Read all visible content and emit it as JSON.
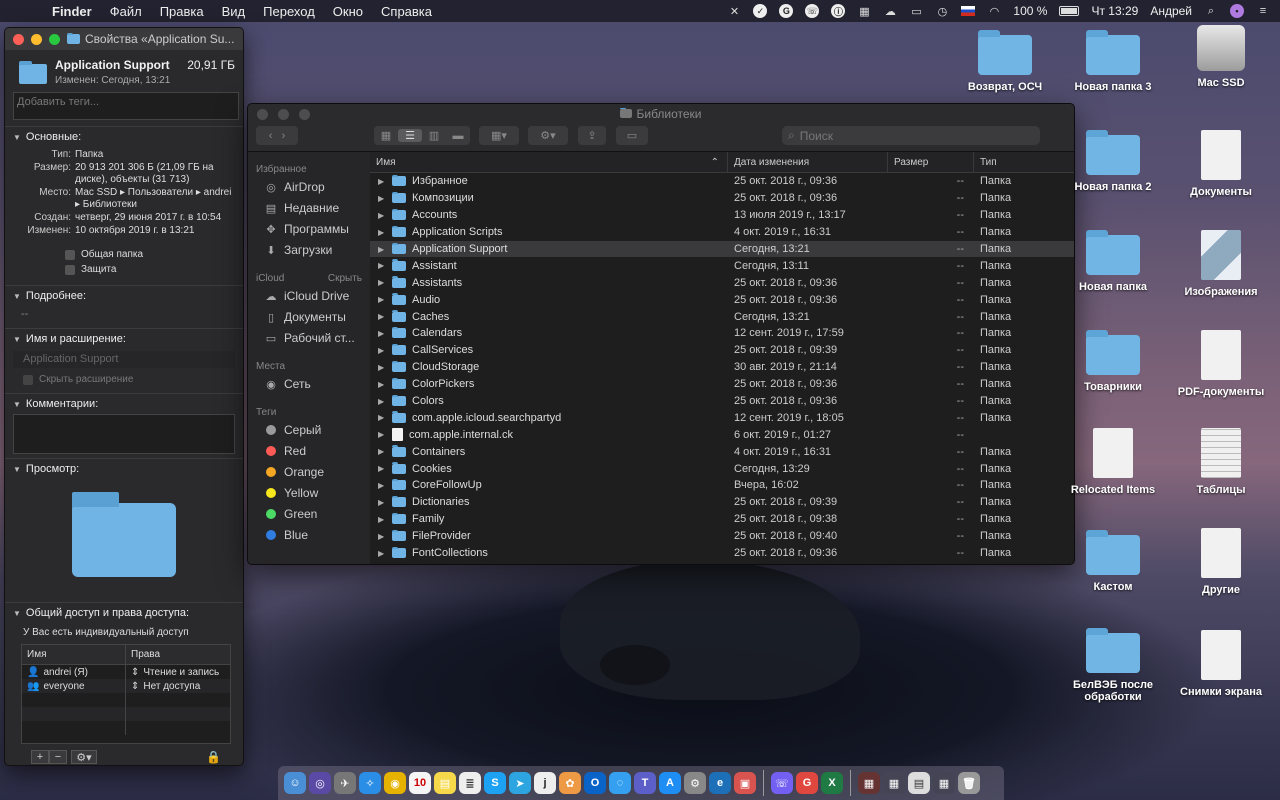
{
  "menubar": {
    "app": "Finder",
    "items": [
      "Файл",
      "Правка",
      "Вид",
      "Переход",
      "Окно",
      "Справка"
    ],
    "battery": "100 %",
    "clock": "Чт 13:29",
    "user": "Андрей"
  },
  "info": {
    "title": "Свойства «Application Su...",
    "name": "Application Support",
    "size": "20,91 ГБ",
    "modified": "Изменен: Сегодня, 13:21",
    "tags_placeholder": "Добавить теги...",
    "general": {
      "header": "Основные:",
      "kind_k": "Тип:",
      "kind_v": "Папка",
      "size_k": "Размер:",
      "size_v": "20 913 201 306 Б (21,09 ГБ на диске), объекты (31 713)",
      "where_k": "Место:",
      "where_v": "Mac SSD ▸ Пользователи ▸ andrei ▸ Библиотеки",
      "created_k": "Создан:",
      "created_v": "четверг, 29 июня 2017 г. в 10:54",
      "modified_k": "Изменен:",
      "modified_v": "10 октября 2019 г. в 13:21",
      "shared": "Общая папка",
      "locked": "Защита"
    },
    "more": {
      "header": "Подробнее:",
      "value": "--"
    },
    "name_ext": {
      "header": "Имя и расширение:",
      "value": "Application Support",
      "hide": "Скрыть расширение"
    },
    "comments": {
      "header": "Комментарии:"
    },
    "preview": {
      "header": "Просмотр:"
    },
    "sharing": {
      "header": "Общий доступ и права доступа:",
      "note": "У Вас есть индивидуальный доступ",
      "col_name": "Имя",
      "col_priv": "Права",
      "rows": [
        {
          "name": "andrei (Я)",
          "priv": "Чтение и запись"
        },
        {
          "name": "everyone",
          "priv": "Нет доступа"
        }
      ]
    }
  },
  "finder": {
    "title": "Библиотеки",
    "search_placeholder": "Поиск",
    "sidebar": {
      "favorites": "Избранное",
      "fav_items": [
        "AirDrop",
        "Недавние",
        "Программы",
        "Загрузки"
      ],
      "icloud": "iCloud",
      "icloud_hide": "Скрыть",
      "icloud_items": [
        "iCloud Drive",
        "Документы",
        "Рабочий ст..."
      ],
      "places": "Места",
      "places_items": [
        "Сеть"
      ],
      "tags": "Теги",
      "tag_items": [
        {
          "name": "Серый",
          "color": "#9a9a9a"
        },
        {
          "name": "Red",
          "color": "#ff5b56"
        },
        {
          "name": "Orange",
          "color": "#f5a623"
        },
        {
          "name": "Yellow",
          "color": "#f8e71c"
        },
        {
          "name": "Green",
          "color": "#4cd964"
        },
        {
          "name": "Blue",
          "color": "#2f7de1"
        }
      ]
    },
    "columns": {
      "name": "Имя",
      "date": "Дата изменения",
      "size": "Размер",
      "kind": "Тип"
    },
    "rows": [
      {
        "name": "Избранное",
        "date": "25 окт. 2018 г., 09:36",
        "size": "--",
        "kind": "Папка"
      },
      {
        "name": "Композиции",
        "date": "25 окт. 2018 г., 09:36",
        "size": "--",
        "kind": "Папка"
      },
      {
        "name": "Accounts",
        "date": "13 июля 2019 г., 13:17",
        "size": "--",
        "kind": "Папка"
      },
      {
        "name": "Application Scripts",
        "date": "4 окт. 2019 г., 16:31",
        "size": "--",
        "kind": "Папка"
      },
      {
        "name": "Application Support",
        "date": "Сегодня, 13:21",
        "size": "--",
        "kind": "Папка"
      },
      {
        "name": "Assistant",
        "date": "Сегодня, 13:11",
        "size": "--",
        "kind": "Папка"
      },
      {
        "name": "Assistants",
        "date": "25 окт. 2018 г., 09:36",
        "size": "--",
        "kind": "Папка"
      },
      {
        "name": "Audio",
        "date": "25 окт. 2018 г., 09:36",
        "size": "--",
        "kind": "Папка"
      },
      {
        "name": "Caches",
        "date": "Сегодня, 13:21",
        "size": "--",
        "kind": "Папка"
      },
      {
        "name": "Calendars",
        "date": "12 сент. 2019 г., 17:59",
        "size": "--",
        "kind": "Папка"
      },
      {
        "name": "CallServices",
        "date": "25 окт. 2018 г., 09:39",
        "size": "--",
        "kind": "Папка"
      },
      {
        "name": "CloudStorage",
        "date": "30 авг. 2019 г., 21:14",
        "size": "--",
        "kind": "Папка"
      },
      {
        "name": "ColorPickers",
        "date": "25 окт. 2018 г., 09:36",
        "size": "--",
        "kind": "Папка"
      },
      {
        "name": "Colors",
        "date": "25 окт. 2018 г., 09:36",
        "size": "--",
        "kind": "Папка"
      },
      {
        "name": "com.apple.icloud.searchpartyd",
        "date": "12 сент. 2019 г., 18:05",
        "size": "--",
        "kind": "Папка"
      },
      {
        "name": "com.apple.internal.ck",
        "date": "6 окт. 2019 г., 01:27",
        "size": "--",
        "kind": ""
      },
      {
        "name": "Containers",
        "date": "4 окт. 2019 г., 16:31",
        "size": "--",
        "kind": "Папка"
      },
      {
        "name": "Cookies",
        "date": "Сегодня, 13:29",
        "size": "--",
        "kind": "Папка"
      },
      {
        "name": "CoreFollowUp",
        "date": "Вчера, 16:02",
        "size": "--",
        "kind": "Папка"
      },
      {
        "name": "Dictionaries",
        "date": "25 окт. 2018 г., 09:39",
        "size": "--",
        "kind": "Папка"
      },
      {
        "name": "Family",
        "date": "25 окт. 2018 г., 09:38",
        "size": "--",
        "kind": "Папка"
      },
      {
        "name": "FileProvider",
        "date": "25 окт. 2018 г., 09:40",
        "size": "--",
        "kind": "Папка"
      },
      {
        "name": "FontCollections",
        "date": "25 окт. 2018 г., 09:36",
        "size": "--",
        "kind": "Папка"
      }
    ]
  },
  "desktop": {
    "items": [
      "Возврат, ОСЧ",
      "Новая папка 3",
      "Mac SSD",
      "Новая папка 2",
      "Документы",
      "Новая папка",
      "Изображения",
      "Товарники",
      "PDF-документы",
      "Relocated Items",
      "Таблицы",
      "Кастом",
      "Другие",
      "БелВЭБ после обработки",
      "Снимки экрана"
    ]
  }
}
